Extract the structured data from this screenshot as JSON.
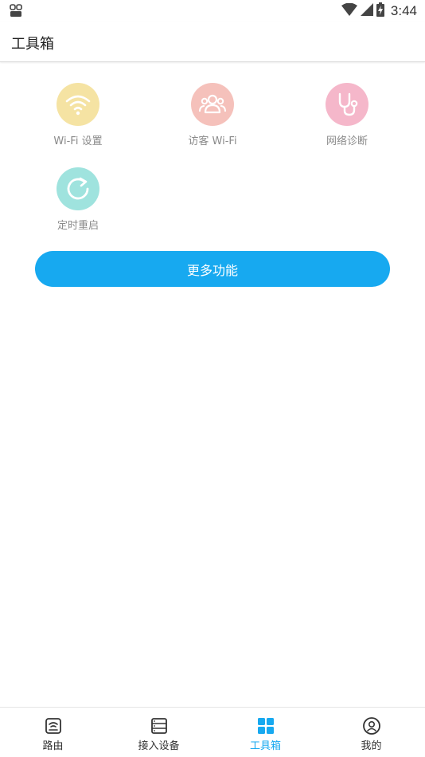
{
  "status_bar": {
    "time": "3:44",
    "left_icon": "notification-icon",
    "icons": [
      "wifi-signal-icon",
      "cell-signal-icon",
      "battery-charging-icon"
    ]
  },
  "app_bar": {
    "title": "工具箱"
  },
  "tools": [
    {
      "label": "Wi-Fi 设置",
      "icon": "wifi-icon",
      "color": "#f5e3a3"
    },
    {
      "label": "访客 Wi-Fi",
      "icon": "guest-users-icon",
      "color": "#f5c1bb"
    },
    {
      "label": "网络诊断",
      "icon": "stethoscope-icon",
      "color": "#f5b7ca"
    },
    {
      "label": "定时重启",
      "icon": "refresh-icon",
      "color": "#9fe3de"
    }
  ],
  "more_button": {
    "label": "更多功能",
    "color": "#17a9f0"
  },
  "bottom_nav": {
    "items": [
      {
        "label": "路由",
        "icon": "router-icon",
        "active": false
      },
      {
        "label": "接入设备",
        "icon": "devices-icon",
        "active": false
      },
      {
        "label": "工具箱",
        "icon": "toolbox-grid-icon",
        "active": true
      },
      {
        "label": "我的",
        "icon": "profile-icon",
        "active": false
      }
    ],
    "active_color": "#17a9f0"
  }
}
